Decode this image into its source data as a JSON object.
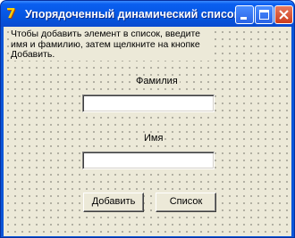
{
  "window": {
    "title": "Упорядоченный динамический список",
    "icon": "delphi-icon"
  },
  "form": {
    "instruction": "Чтобы добавить элемент в список, введите\nимя и фамилию, затем щелкните на кнопке\nДобавить.",
    "surname_label": "Фамилия",
    "surname_value": "",
    "name_label": "Имя",
    "name_value": "",
    "add_button": "Добавить",
    "list_button": "Список"
  }
}
